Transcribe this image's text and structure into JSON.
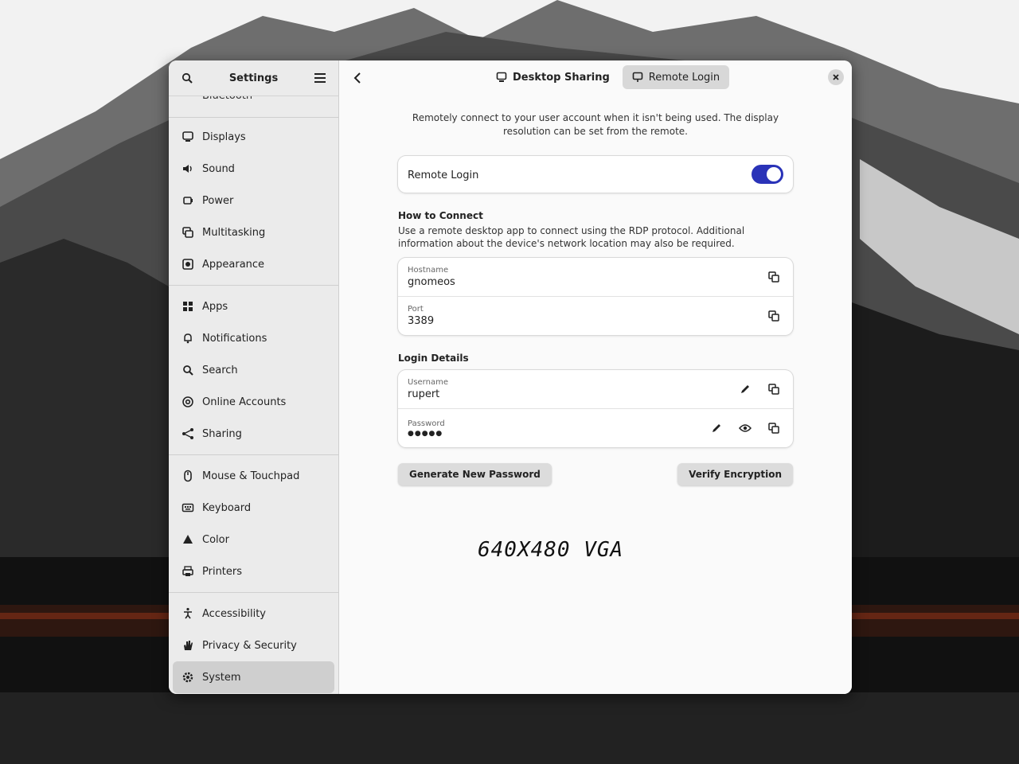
{
  "sidebar": {
    "title": "Settings",
    "partial_item": "Bluetooth",
    "groups": [
      [
        {
          "name": "displays",
          "label": "Displays",
          "icon": "display-icon"
        },
        {
          "name": "sound",
          "label": "Sound",
          "icon": "sound-icon"
        },
        {
          "name": "power",
          "label": "Power",
          "icon": "power-icon"
        },
        {
          "name": "multitasking",
          "label": "Multitasking",
          "icon": "multitasking-icon"
        },
        {
          "name": "appearance",
          "label": "Appearance",
          "icon": "appearance-icon"
        }
      ],
      [
        {
          "name": "apps",
          "label": "Apps",
          "icon": "apps-icon"
        },
        {
          "name": "notifications",
          "label": "Notifications",
          "icon": "bell-icon"
        },
        {
          "name": "search",
          "label": "Search",
          "icon": "search-icon"
        },
        {
          "name": "online-accounts",
          "label": "Online Accounts",
          "icon": "at-icon"
        },
        {
          "name": "sharing",
          "label": "Sharing",
          "icon": "share-icon"
        }
      ],
      [
        {
          "name": "mouse-touchpad",
          "label": "Mouse & Touchpad",
          "icon": "mouse-icon"
        },
        {
          "name": "keyboard",
          "label": "Keyboard",
          "icon": "keyboard-icon"
        },
        {
          "name": "color",
          "label": "Color",
          "icon": "color-icon"
        },
        {
          "name": "printers",
          "label": "Printers",
          "icon": "printer-icon"
        }
      ],
      [
        {
          "name": "accessibility",
          "label": "Accessibility",
          "icon": "accessibility-icon"
        },
        {
          "name": "privacy-security",
          "label": "Privacy & Security",
          "icon": "hand-icon"
        },
        {
          "name": "system",
          "label": "System",
          "icon": "gear-icon",
          "active": true
        }
      ]
    ]
  },
  "header": {
    "tabs": [
      {
        "label": "Desktop Sharing",
        "icon": "monitor-icon",
        "active": false
      },
      {
        "label": "Remote Login",
        "icon": "remote-icon",
        "active": true
      }
    ]
  },
  "main": {
    "description": "Remotely connect to your user account when it isn't being used. The display resolution can be set from the remote.",
    "remote_login_label": "Remote Login",
    "remote_login_enabled": true,
    "how_to_connect": {
      "title": "How to Connect",
      "description": "Use a remote desktop app to connect using the RDP protocol. Additional information about the device's network location may also be required.",
      "fields": [
        {
          "label": "Hostname",
          "value": "gnomeos"
        },
        {
          "label": "Port",
          "value": "3389"
        }
      ]
    },
    "login_details": {
      "title": "Login Details",
      "username_label": "Username",
      "username_value": "rupert",
      "password_label": "Password",
      "password_value": "●●●●●"
    },
    "generate_button": "Generate New Password",
    "verify_button": "Verify Encryption"
  },
  "overlay_caption": "640X480 VGA",
  "colors": {
    "accent": "#2a33b8",
    "sidebar_bg": "#ebebeb",
    "window_bg": "#fafafa"
  }
}
